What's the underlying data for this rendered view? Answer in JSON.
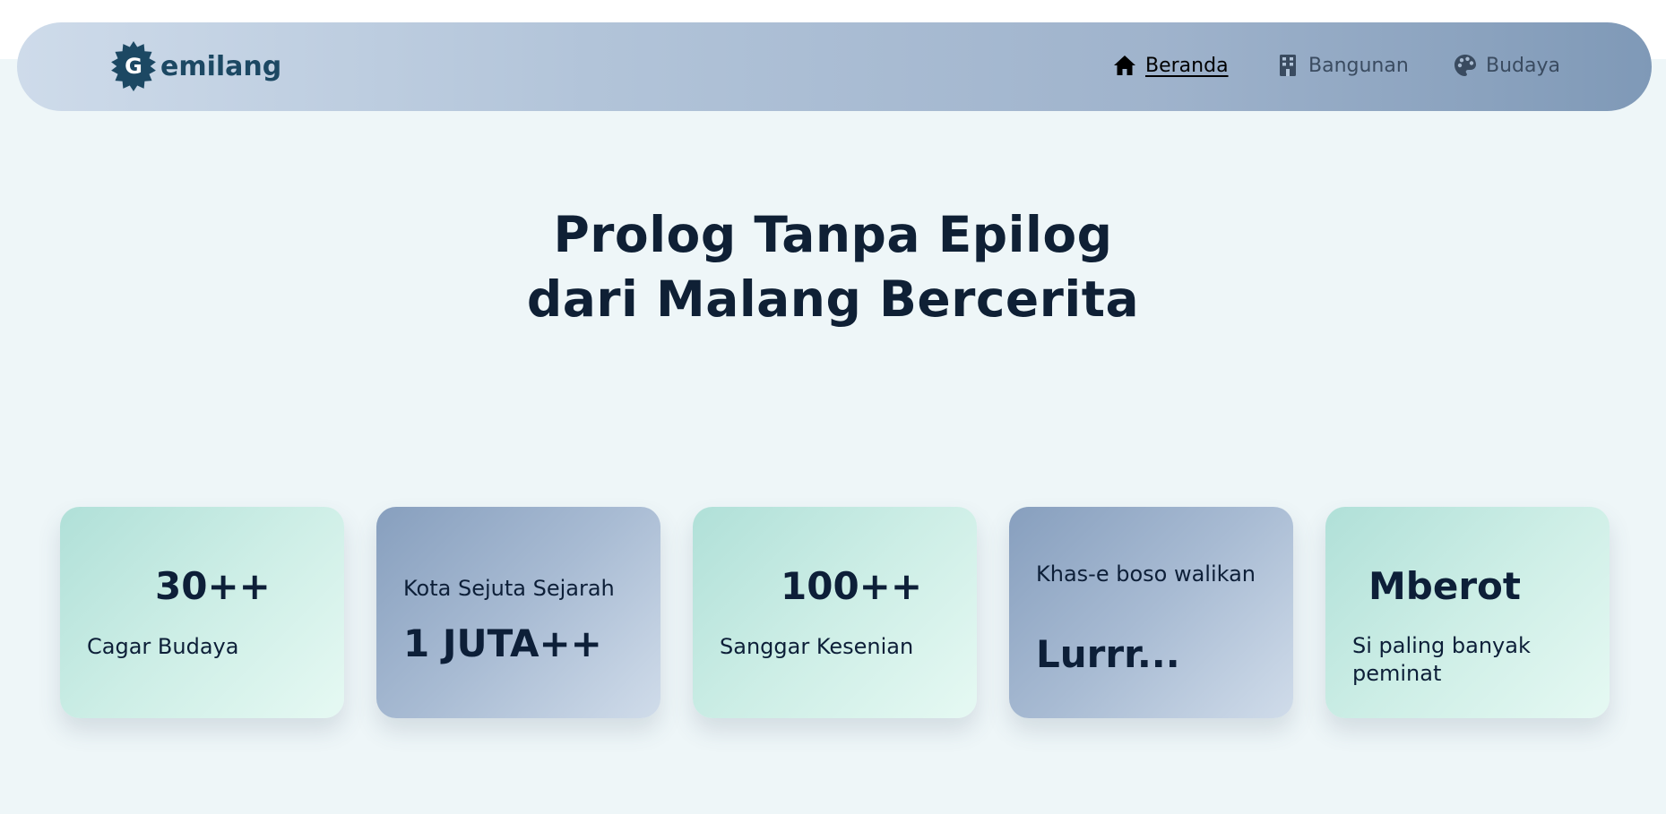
{
  "navbar": {
    "brand": {
      "badge_letter": "G",
      "rest": "emilang"
    },
    "items": [
      {
        "icon": "home-icon",
        "label": "Beranda",
        "active": true
      },
      {
        "icon": "building-icon",
        "label": "Bangunan",
        "active": false
      },
      {
        "icon": "palette-icon",
        "label": "Budaya",
        "active": false
      }
    ]
  },
  "hero": {
    "line1": "Prolog Tanpa Epilog",
    "line2": "dari Malang Bercerita"
  },
  "cards": [
    {
      "big": "30++",
      "small": "Cagar Budaya",
      "style": "teal"
    },
    {
      "small": "Kota Sejuta Sejarah",
      "big": "1 JUTA++",
      "style": "blue"
    },
    {
      "big": "100++",
      "small": "Sanggar Kesenian",
      "style": "teal"
    },
    {
      "small": "Khas-e boso walikan",
      "big": "Lurrr...",
      "style": "blue"
    },
    {
      "big": "Mberot",
      "small": "Si paling banyak peminat",
      "style": "teal"
    }
  ],
  "colors": {
    "page_bg": "#eef6f8",
    "text_dark": "#0d1f38",
    "brand": "#1c4863",
    "navbar_start": "#cedbea",
    "navbar_end": "#7f99b7",
    "card_teal": "#b0e0d8",
    "card_blue": "#879fbe"
  }
}
